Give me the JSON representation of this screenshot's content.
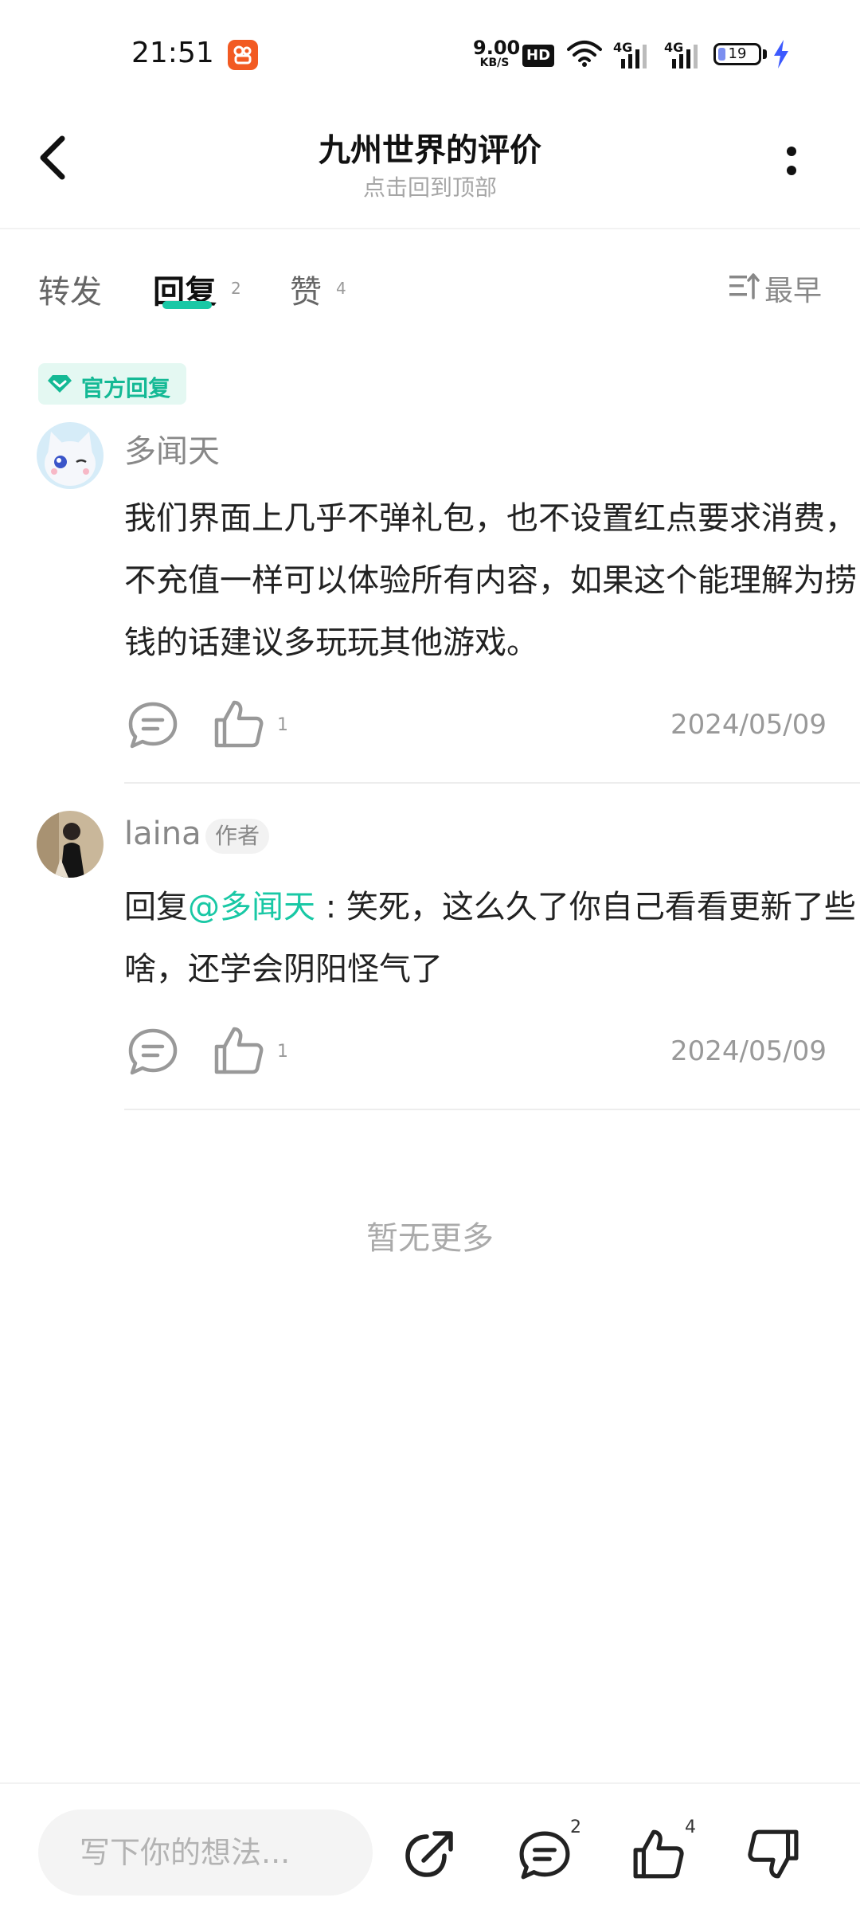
{
  "status_bar": {
    "time": "21:51",
    "net_speed_value": "9.00",
    "net_speed_unit": "KB/S",
    "hd_label": "HD",
    "signal1_label": "4G",
    "signal2_label": "4G",
    "battery_level": "19",
    "battery_fraction": 0.19
  },
  "header": {
    "title": "九州世界的评价",
    "subtitle": "点击回到顶部"
  },
  "tabs": {
    "forward_label": "转发",
    "reply_label": "回复",
    "reply_count": "2",
    "like_label": "赞",
    "like_count": "4",
    "sort_label": "最早"
  },
  "official_badge": "官方回复",
  "comments": [
    {
      "username": "多闻天",
      "text": "我们界面上几乎不弹礼包，也不设置红点要求消费，不充值一样可以体验所有内容，如果这个能理解为捞钱的话建议多玩玩其他游戏。",
      "likes": "1",
      "date": "2024/05/09"
    },
    {
      "username": "laina",
      "tag": "作者",
      "reply_prefix": "回复",
      "mention": "@多闻天",
      "text": " : 笑死，这么久了你自己看看更新了些啥，还学会阴阳怪气了",
      "likes": "1",
      "date": "2024/05/09"
    }
  ],
  "no_more_text": "暂无更多",
  "bottom_bar": {
    "input_placeholder": "写下你的想法...",
    "comment_count": "2",
    "like_count": "4"
  },
  "colors": {
    "accent": "#19c8a5",
    "official_bg": "#e4f8f2",
    "notif_app": "#f25a22",
    "charging": "#3d5afe"
  }
}
